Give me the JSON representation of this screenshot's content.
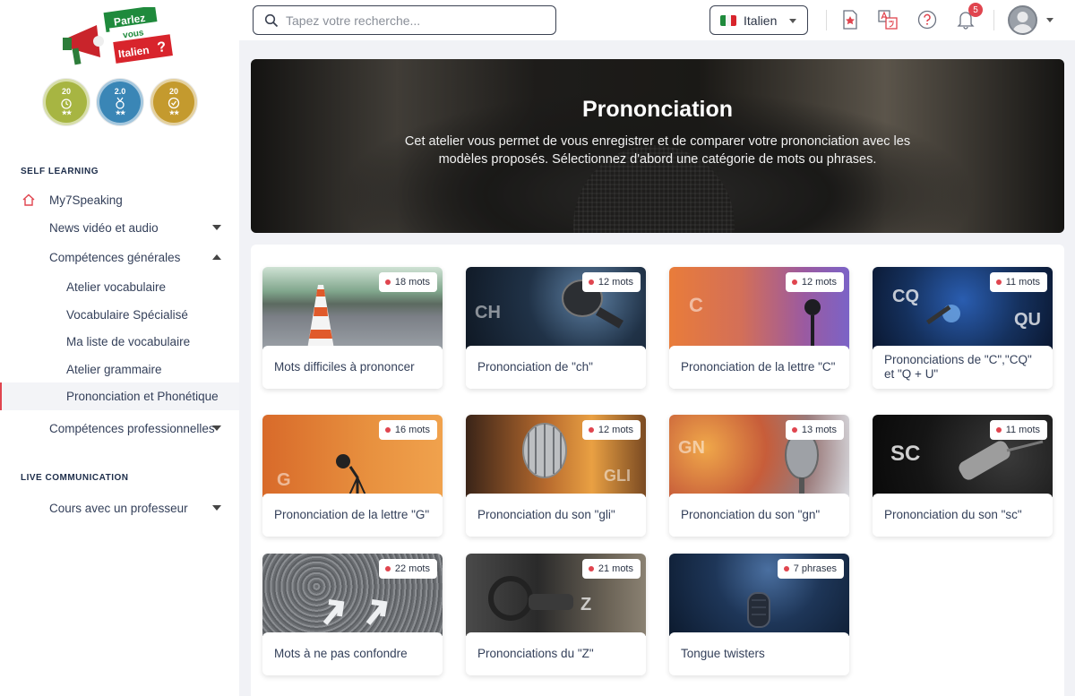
{
  "sidebar": {
    "logo": {
      "line1": "Parlez",
      "line2": "vous",
      "line3": "Italien",
      "mark": "?"
    },
    "badges": [
      {
        "num": "20",
        "stars": "★★",
        "color": "#a7b542",
        "icon": "alarm-clock-icon"
      },
      {
        "num": "2.0",
        "stars": "★★",
        "color": "#3a86b6",
        "icon": "medal-icon"
      },
      {
        "num": "20",
        "stars": "★★",
        "color": "#c49a2e",
        "icon": "check-circle-icon"
      }
    ],
    "self_learning_title": "SELF LEARNING",
    "live_title": "LIVE COMMUNICATION",
    "items": [
      {
        "label": "My7Speaking"
      },
      {
        "label": "News vidéo et audio"
      },
      {
        "label": "Compétences générales"
      },
      {
        "label": "Atelier vocabulaire"
      },
      {
        "label": "Vocabulaire Spécialisé"
      },
      {
        "label": "Ma liste de vocabulaire"
      },
      {
        "label": "Atelier grammaire"
      },
      {
        "label": "Prononciation et Phonétique"
      },
      {
        "label": "Compétences professionnelles"
      },
      {
        "label": "Cours avec un professeur"
      }
    ]
  },
  "topbar": {
    "search_placeholder": "Tapez votre recherche...",
    "language": "Italien",
    "notification_count": "5",
    "accent": "#e0454f"
  },
  "hero": {
    "title": "Prononciation",
    "description": "Cet atelier vous permet de vous enregistrer et de comparer votre prononciation avec les modèles proposés. Sélectionnez d'abord une catégorie de mots ou phrases."
  },
  "cards": [
    {
      "label": "Mots difficiles à prononcer",
      "count": "18 mots"
    },
    {
      "label": "Prononciation de \"ch\"",
      "count": "12 mots",
      "overlay": "CH"
    },
    {
      "label": "Prononciation de la lettre \"C\"",
      "count": "12 mots",
      "overlay": "C"
    },
    {
      "label": "Prononciations de \"C\",\"CQ\" et \"Q + U\"",
      "count": "11 mots",
      "overlay": "CQ",
      "overlay2": "QU"
    },
    {
      "label": "Prononciation de la lettre \"G\"",
      "count": "16 mots",
      "overlay": "G"
    },
    {
      "label": "Prononciation du son \"gli\"",
      "count": "12 mots",
      "overlay": "GLI"
    },
    {
      "label": "Prononciation du son \"gn\"",
      "count": "13 mots",
      "overlay": "GN"
    },
    {
      "label": "Prononciation du son \"sc\"",
      "count": "11 mots",
      "overlay": "SC"
    },
    {
      "label": "Mots à ne pas confondre",
      "count": "22 mots"
    },
    {
      "label": "Prononciations du \"Z\"",
      "count": "21 mots",
      "overlay": "Z"
    },
    {
      "label": "Tongue twisters",
      "count": "7 phrases"
    }
  ]
}
